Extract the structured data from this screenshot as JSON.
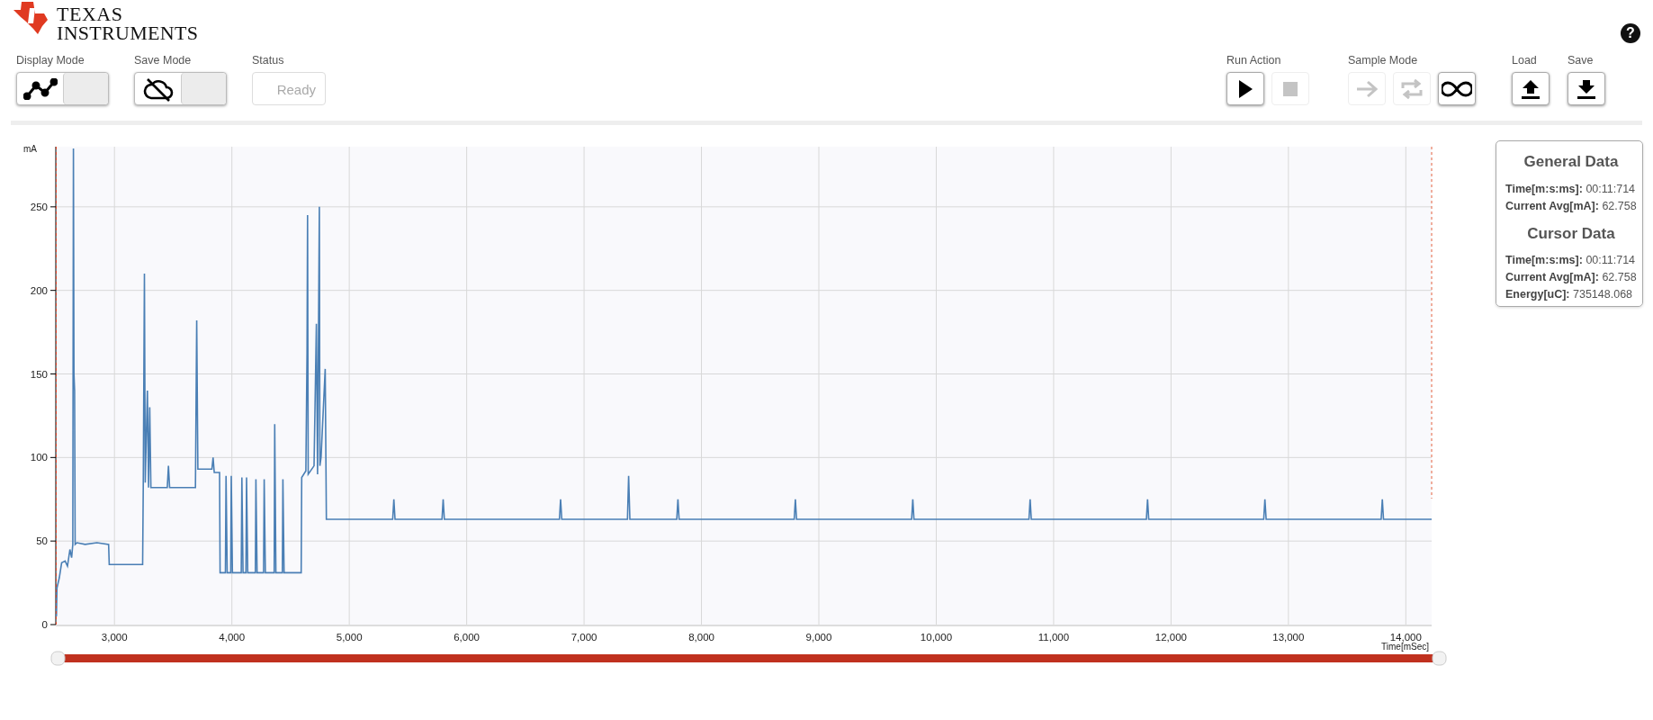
{
  "header": {
    "logo_line1": "TEXAS",
    "logo_line2": "INSTRUMENTS",
    "help": "?"
  },
  "toolbar": {
    "display_mode": {
      "label": "Display Mode",
      "kind": "graph",
      "on": false
    },
    "save_mode": {
      "label": "Save Mode",
      "kind": "cloud-off",
      "on": false
    },
    "status": {
      "label": "Status",
      "value": "Ready"
    },
    "run_action": {
      "label": "Run Action",
      "buttons": [
        {
          "kind": "play",
          "disabled": false
        },
        {
          "kind": "stop",
          "disabled": true
        }
      ]
    },
    "sample_mode": {
      "label": "Sample Mode",
      "buttons": [
        {
          "kind": "single",
          "disabled": true
        },
        {
          "kind": "repeat",
          "disabled": true
        },
        {
          "kind": "continuous",
          "disabled": false
        }
      ]
    },
    "load": {
      "label": "Load",
      "kind": "upload"
    },
    "save": {
      "label": "Save",
      "kind": "download"
    }
  },
  "chart": {
    "chart_data": {
      "type": "line",
      "grid": true,
      "ylabel": "mA",
      "xlabel": "Time[mSec]",
      "xlim": [
        2500,
        14220
      ],
      "ylim": [
        0,
        286
      ],
      "xticks": [
        {
          "value": 3000,
          "label": "3,000"
        },
        {
          "value": 4000,
          "label": "4,000"
        },
        {
          "value": 5000,
          "label": "5,000"
        },
        {
          "value": 6000,
          "label": "6,000"
        },
        {
          "value": 7000,
          "label": "7,000"
        },
        {
          "value": 8000,
          "label": "8,000"
        },
        {
          "value": 9000,
          "label": "9,000"
        },
        {
          "value": 10000,
          "label": "10,000"
        },
        {
          "value": 11000,
          "label": "11,000"
        },
        {
          "value": 12000,
          "label": "12,000"
        },
        {
          "value": 13000,
          "label": "13,000"
        },
        {
          "value": 14000,
          "label": "14,000"
        }
      ],
      "yticks": [
        0,
        50,
        100,
        150,
        200,
        250
      ],
      "x": [
        2505,
        2510,
        2530,
        2550,
        2580,
        2600,
        2620,
        2635,
        2645,
        2650,
        2655,
        2660,
        2665,
        2680,
        2750,
        2850,
        2950,
        2955,
        3240,
        3245,
        3255,
        3262,
        3280,
        3290,
        3300,
        3310,
        3450,
        3460,
        3470,
        3690,
        3700,
        3710,
        3830,
        3840,
        3850,
        3895,
        3900,
        3945,
        3950,
        3960,
        3990,
        3995,
        4005,
        4080,
        4085,
        4095,
        4120,
        4125,
        4135,
        4200,
        4205,
        4215,
        4270,
        4275,
        4285,
        4360,
        4365,
        4375,
        4430,
        4435,
        4445,
        4590,
        4595,
        4630,
        4640,
        4645,
        4650,
        4700,
        4720,
        4730,
        4745,
        4750,
        4760,
        4795,
        4805,
        5370,
        5380,
        5390,
        5790,
        5800,
        5810,
        6790,
        6800,
        6810,
        7370,
        7380,
        7390,
        7790,
        7800,
        7810,
        8790,
        8800,
        8810,
        9790,
        9800,
        9810,
        10790,
        10800,
        10810,
        11790,
        11800,
        11810,
        12790,
        12800,
        12810,
        13790,
        13800,
        13810,
        14220
      ],
      "series": [
        {
          "color": "#4a7fb5",
          "values": [
            5,
            22,
            28,
            37,
            38,
            35,
            45,
            40,
            48,
            285,
            150,
            140,
            48,
            49,
            48,
            49,
            48,
            36,
            36,
            82,
            210,
            85,
            140,
            82,
            130,
            82,
            82,
            95,
            82,
            82,
            182,
            93,
            93,
            100,
            91,
            91,
            31,
            31,
            89,
            31,
            31,
            89,
            31,
            31,
            88,
            31,
            31,
            88,
            31,
            31,
            87,
            31,
            31,
            87,
            31,
            31,
            120,
            31,
            31,
            87,
            31,
            31,
            88,
            92,
            163,
            245,
            90,
            95,
            180,
            90,
            250,
            95,
            100,
            153,
            63,
            63,
            75,
            63,
            63,
            75,
            63,
            63,
            75,
            63,
            63,
            89,
            63,
            63,
            75,
            63,
            63,
            75,
            63,
            63,
            75,
            63,
            63,
            75,
            63,
            63,
            75,
            63,
            63,
            75,
            63,
            63,
            75,
            63,
            63
          ]
        }
      ]
    }
  },
  "info": [
    {
      "title": "General Data",
      "rows": [
        {
          "label": "Time[m:s:ms]:",
          "value": "00:11:714"
        },
        {
          "label": "Current Avg[mA]:",
          "value": "62.758"
        }
      ]
    },
    {
      "title": "Cursor Data",
      "rows": [
        {
          "label": "Time[m:s:ms]:",
          "value": "00:11:714"
        },
        {
          "label": "Current Avg[mA]:",
          "value": "62.758"
        },
        {
          "label": "Energy[uC]:",
          "value": "735148.068"
        }
      ]
    }
  ]
}
